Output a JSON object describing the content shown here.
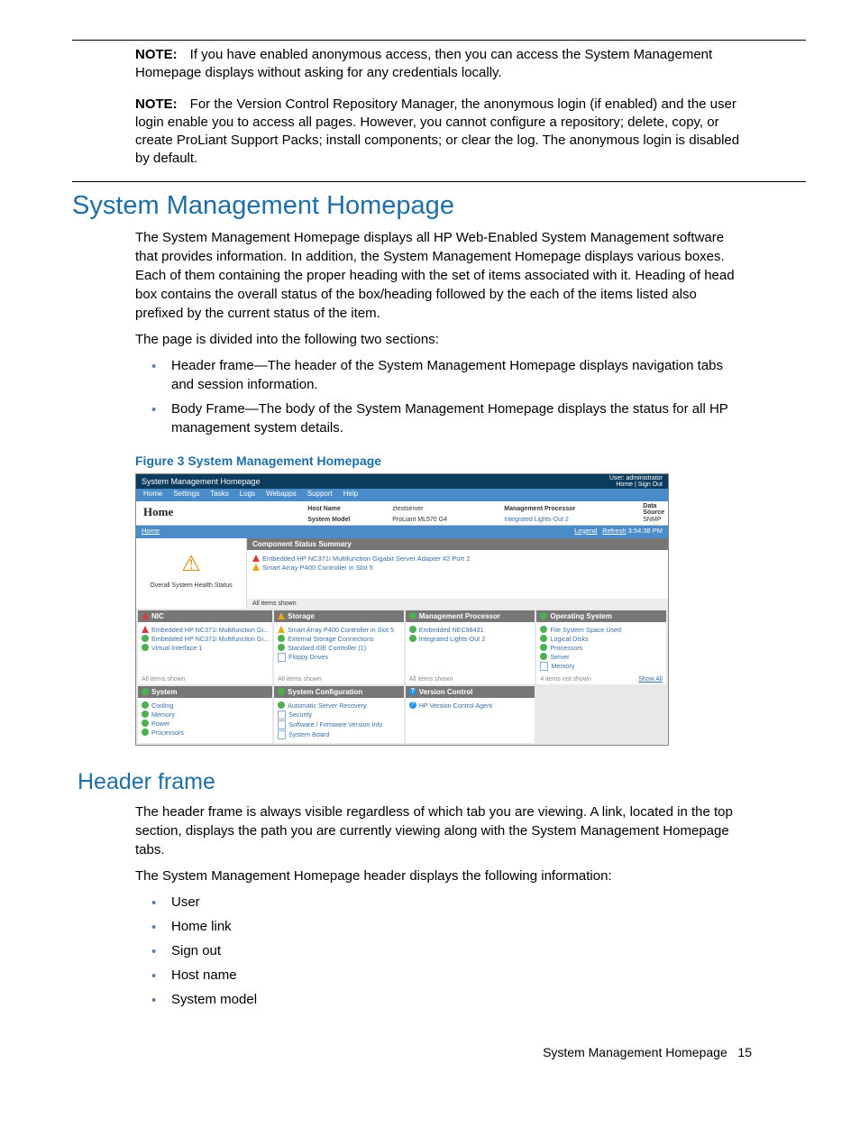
{
  "notes": {
    "label": "NOTE:",
    "n1": "If you have enabled anonymous access, then you can access the System Management Homepage displays without asking for any credentials locally.",
    "n2": "For the Version Control Repository Manager, the anonymous login (if enabled) and the user login enable you to access all pages. However, you cannot configure a repository; delete, copy, or create ProLiant Support Packs; install components; or clear the log. The anonymous login is disabled by default."
  },
  "h1": "System Management Homepage",
  "para1": "The System Management Homepage displays all HP Web-Enabled System Management software that provides information. In addition, the System Management Homepage displays various boxes. Each of them containing the proper heading with the set of items associated with it. Heading of head box contains the overall status of the box/heading followed by the each of the items listed also prefixed by the current status of the item.",
  "para2": "The page is divided into the following two sections:",
  "sections": {
    "a": "Header frame—The header of the System Management Homepage displays navigation tabs and session information.",
    "b": "Body Frame—The body of the System Management Homepage displays the status for all HP management system details."
  },
  "figcap": "Figure 3 System Management Homepage",
  "shot": {
    "title": "System Management Homepage",
    "user": "User: administrator",
    "links": "Home | Sign Out",
    "menu": [
      "Home",
      "Settings",
      "Tasks",
      "Logs",
      "Webapps",
      "Support",
      "Help"
    ],
    "home": "Home",
    "hostname_l": "Host Name",
    "hostname_v": "ztestserver",
    "sysmodel_l": "System Model",
    "sysmodel_v": "ProLiant ML570 G4",
    "mproc_l": "Management Processor",
    "mproc_v": "Integrated Lights-Out 2",
    "ds_l": "Data Source",
    "ds_v": "SNMP",
    "crumb": "Home",
    "legend": "Legend",
    "refresh": "Refresh",
    "time": "3:54:38 PM",
    "health": "Overall System Health Status",
    "compstat": "Component Status Summary",
    "cs1": "Embedded HP NC371i Multifunction Gigabit Server Adapter #2 Port 2",
    "cs2": "Smart Array P400 Controller in Slot 5",
    "allshown": "All items shown",
    "cards": {
      "nic": {
        "h": "NIC",
        "i": [
          "Embedded HP NC371i Multifunction Gi...",
          "Embedded HP NC371i Multifunction Gi...",
          "Virtual Interface 1"
        ],
        "f": "All items shown"
      },
      "storage": {
        "h": "Storage",
        "i": [
          "Smart Array P400 Controller in Slot 5",
          "External Storage Connections",
          "Standard IDE Controller (1)",
          "Floppy Drives"
        ],
        "f": "All items shown"
      },
      "mp": {
        "h": "Management Processor",
        "i": [
          "Embedded NEC98431",
          "Integrated Lights-Out 2"
        ],
        "f": "All items shown"
      },
      "os": {
        "h": "Operating System",
        "i": [
          "File System Space Used",
          "Logical Disks",
          "Processors",
          "Server",
          "Memory"
        ],
        "f": "4 items not shown",
        "show": "Show All"
      },
      "sys": {
        "h": "System",
        "i": [
          "Cooling",
          "Memory",
          "Power",
          "Processors"
        ]
      },
      "sc": {
        "h": "System Configuration",
        "i": [
          "Automatic Server Recovery",
          "Security",
          "Software / Firmware Version Info",
          "System Board"
        ]
      },
      "vc": {
        "h": "Version Control",
        "i": [
          "HP Version Control Agent"
        ]
      }
    }
  },
  "h2": "Header frame",
  "hf1": "The header frame is always visible regardless of which tab you are viewing. A link, located in the top section, displays the path you are currently viewing along with the System Management Homepage tabs.",
  "hf2": "The System Management Homepage header displays the following information:",
  "hflist": [
    "User",
    "Home link",
    "Sign out",
    "Host name",
    "System model"
  ],
  "footer": {
    "title": "System Management Homepage",
    "page": "15"
  }
}
